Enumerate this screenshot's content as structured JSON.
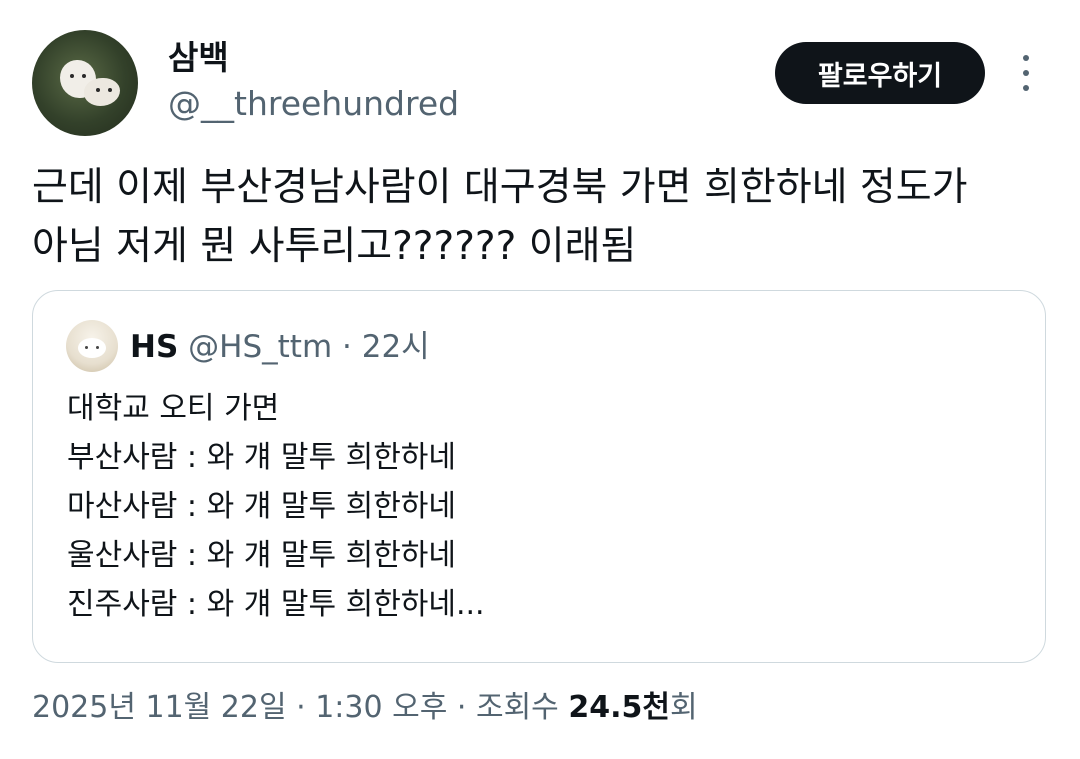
{
  "author": {
    "display_name": "삼백",
    "handle": "@__threehundred",
    "avatar_icon": "dogs-on-grass-avatar"
  },
  "follow_button": {
    "label": "팔로우하기"
  },
  "more_icon": "more-vertical-icon",
  "tweet": {
    "lines": [
      "근데 이제 부산경남사람이 대구경북 가면 희한하네 정도가",
      "아님 저게 뭔 사투리고?????? 이래됨"
    ]
  },
  "quote": {
    "name": "HS",
    "handle": "@HS_ttm",
    "separator": "·",
    "time": "22시",
    "avatar_icon": "white-cat-plush-avatar",
    "lines": [
      "대학교 오티 가면",
      "부산사람 : 와 걔 말투 희한하네",
      "마산사람 : 와 걔 말투 희한하네",
      "울산사람 : 와 걔 말투 희한하네",
      "진주사람 : 와 걔 말투 희한하네..."
    ]
  },
  "meta": {
    "date": "2025년 11월 22일",
    "separator": "·",
    "time": "1:30 오후",
    "views_label": "조회수",
    "views_count": "24.5천",
    "views_suffix": "회"
  },
  "colors": {
    "text_primary": "#0f1419",
    "text_secondary": "#536471",
    "border": "#cfd9de",
    "button_bg": "#0f1419"
  }
}
